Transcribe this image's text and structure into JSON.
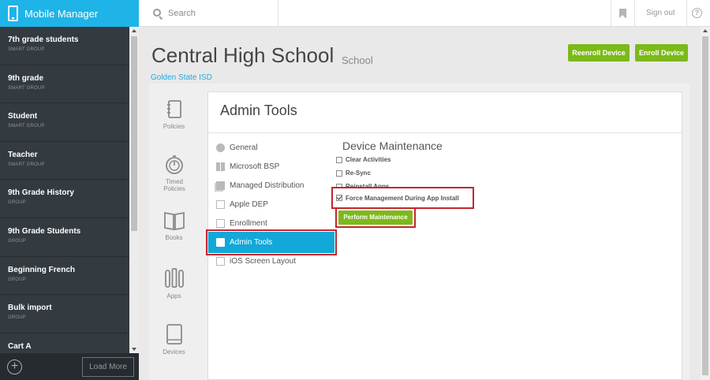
{
  "sidebar": {
    "app_title": "Mobile Manager",
    "items": [
      {
        "name": "7th grade students",
        "type": "SMART GROUP"
      },
      {
        "name": "9th grade",
        "type": "SMART GROUP"
      },
      {
        "name": "Student",
        "type": "SMART GROUP"
      },
      {
        "name": "Teacher",
        "type": "SMART GROUP"
      },
      {
        "name": "9th Grade History",
        "type": "GROUP"
      },
      {
        "name": "9th Grade Students",
        "type": "GROUP"
      },
      {
        "name": "Beginning French",
        "type": "GROUP"
      },
      {
        "name": "Bulk import",
        "type": "GROUP"
      },
      {
        "name": "Cart A",
        "type": ""
      }
    ],
    "add_symbol": "+",
    "load_more": "Load More"
  },
  "topbar": {
    "search_placeholder": "Search",
    "sign_out": "Sign out",
    "help_symbol": "?"
  },
  "header": {
    "title": "Central High School",
    "subtitle": "School",
    "org": "Golden State ISD",
    "reenroll": "Reenroll Device",
    "enroll": "Enroll Device"
  },
  "left_nav": [
    {
      "label": "Policies"
    },
    {
      "label": "Timed Policies"
    },
    {
      "label": "Books"
    },
    {
      "label": "Apps"
    },
    {
      "label": "Devices"
    }
  ],
  "admin": {
    "title": "Admin Tools",
    "menu": [
      "General",
      "Microsoft BSP",
      "Managed Distribution",
      "Apple DEP",
      "Enrollment",
      "Admin Tools",
      "iOS Screen Layout"
    ],
    "selected": "Admin Tools"
  },
  "maintenance": {
    "title": "Device Maintenance",
    "options": [
      {
        "label": "Clear Activities",
        "checked": false
      },
      {
        "label": "Re-Sync",
        "checked": false
      },
      {
        "label": "Reinstall Apps",
        "checked": false
      },
      {
        "label": "Force Management During App Install",
        "checked": true
      }
    ],
    "perform": "Perform Maintenance"
  },
  "colors": {
    "accent": "#1eb4e8",
    "green": "#7cb91a",
    "highlight": "#c4262e",
    "sidebar_bg": "#333a40"
  }
}
